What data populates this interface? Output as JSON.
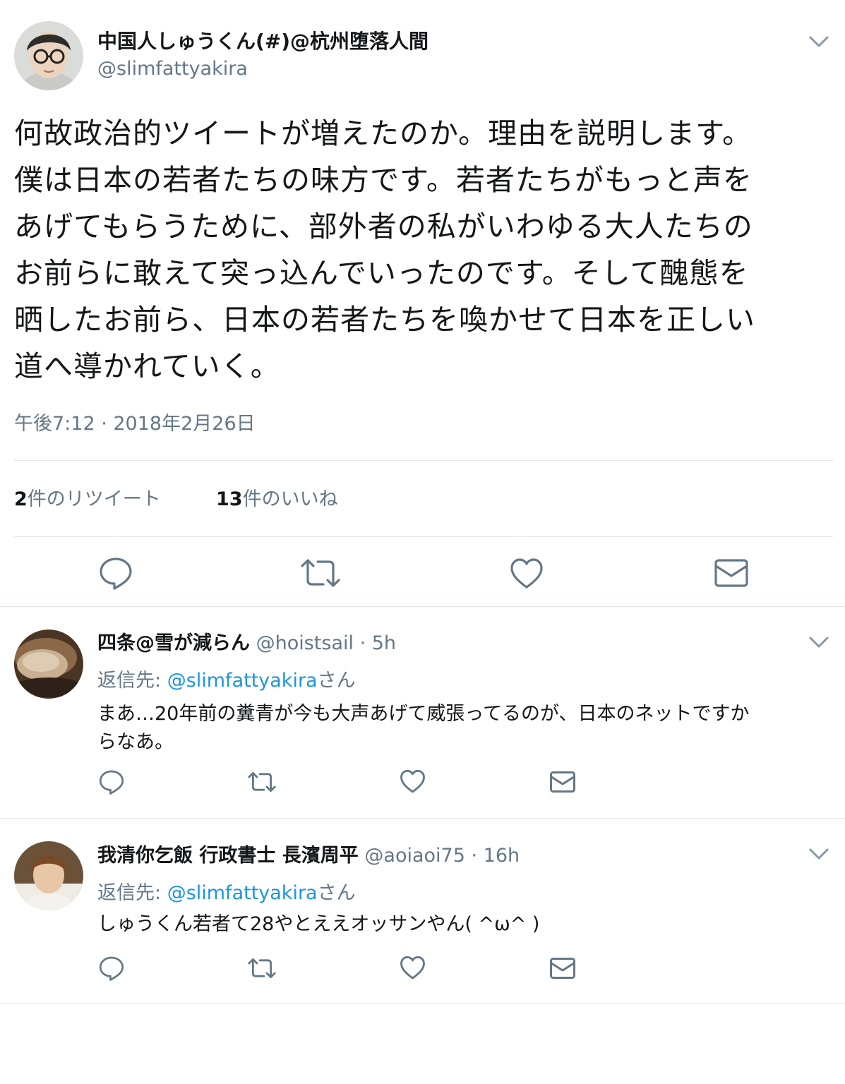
{
  "main_tweet": {
    "author_name": "中国人しゅうくん(#)@杭州堕落人間",
    "handle": "@slimfattyakira",
    "lines": [
      "何故政治的ツイートが増えたのか。理由を説明します。",
      "僕は日本の若者たちの味方です。若者たちがもっと声を",
      "あげてもらうために、部外者の私がいわゆる大人たちの",
      "お前らに敢えて突っ込んでいったのです。そして醜態を",
      "晒したお前ら、日本の若者たちを喚かせて日本を正しい",
      "道へ導かれていく。"
    ],
    "timestamp": "午後7:12 · 2018年2月26日",
    "retweet_count": "2",
    "retweet_label": "件のリツイート",
    "like_count": "13",
    "like_label_a": "件の",
    "like_label_b": "いいね"
  },
  "replies": [
    {
      "author_name": "四条@雪が減らん",
      "handle": "@hoistsail",
      "time": "· 5h",
      "reply_to_prefix": "返信先: ",
      "reply_to_handle": "@slimfattyakira",
      "reply_to_suffix": "さん",
      "lines": [
        "まあ…20年前の糞青が今も大声あげて威張ってるのが、日本のネットですか",
        "らなあ。"
      ]
    },
    {
      "author_name": "我清你乞飯 行政書士 長濱周平",
      "handle": "@aoiaoi75",
      "time": "· 16h",
      "reply_to_prefix": "返信先: ",
      "reply_to_handle": "@slimfattyakira",
      "reply_to_suffix": "さん",
      "lines": [
        "しゅうくん若者て28やとええオッサンやん( ^ω^ )"
      ]
    }
  ],
  "colors": {
    "text": "#14171a",
    "secondary": "#657786",
    "link": "#1b95e0",
    "divider": "#e1e8ed"
  }
}
